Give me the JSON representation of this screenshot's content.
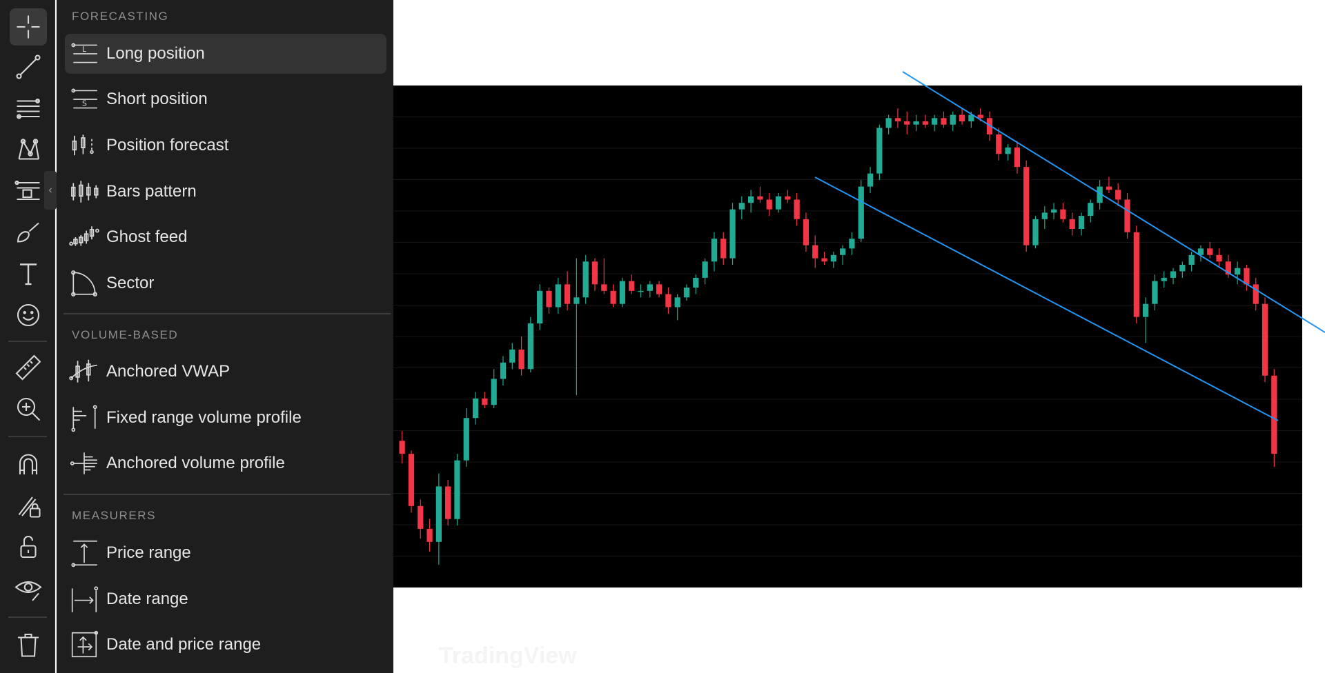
{
  "colors": {
    "panel_bg": "#1e1e1e",
    "chart_bg": "#000000",
    "up_candle": "#22ab94",
    "down_candle": "#f23645",
    "trendline": "#2196f3",
    "icon": "#d6d6d6"
  },
  "toolbar": {
    "items": [
      {
        "name": "crosshair-icon",
        "active": true
      },
      {
        "name": "trend-line-icon"
      },
      {
        "name": "fib-retracement-icon"
      },
      {
        "name": "patterns-icon"
      },
      {
        "name": "forecasting-icon"
      },
      {
        "name": "brush-icon"
      },
      {
        "name": "text-icon"
      },
      {
        "name": "emoji-icon"
      },
      {
        "name": "ruler-icon"
      },
      {
        "name": "zoom-in-icon"
      },
      {
        "name": "magnet-icon"
      },
      {
        "name": "lock-drawing-icon"
      },
      {
        "name": "unlock-icon"
      },
      {
        "name": "eye-icon"
      },
      {
        "name": "trash-icon"
      }
    ],
    "collapse_glyph": "‹"
  },
  "menu": {
    "sections": [
      {
        "title": "FORECASTING",
        "items": [
          {
            "label": "Long position",
            "icon": "long-position-icon",
            "selected": true
          },
          {
            "label": "Short position",
            "icon": "short-position-icon"
          },
          {
            "label": "Position forecast",
            "icon": "position-forecast-icon"
          },
          {
            "label": "Bars pattern",
            "icon": "bars-pattern-icon"
          },
          {
            "label": "Ghost feed",
            "icon": "ghost-feed-icon"
          },
          {
            "label": "Sector",
            "icon": "sector-icon"
          }
        ]
      },
      {
        "title": "VOLUME-BASED",
        "items": [
          {
            "label": "Anchored VWAP",
            "icon": "anchored-vwap-icon"
          },
          {
            "label": "Fixed range volume profile",
            "icon": "fixed-range-volume-profile-icon"
          },
          {
            "label": "Anchored volume profile",
            "icon": "anchored-volume-profile-icon"
          }
        ]
      },
      {
        "title": "MEASURERS",
        "items": [
          {
            "label": "Price range",
            "icon": "price-range-icon"
          },
          {
            "label": "Date range",
            "icon": "date-range-icon"
          },
          {
            "label": "Date and price range",
            "icon": "date-and-price-range-icon"
          }
        ]
      }
    ]
  },
  "chart_data": {
    "type": "candlestick",
    "ylim": [
      0,
      100
    ],
    "grid": true,
    "candles": [
      {
        "o": 40,
        "h": 43,
        "l": 33,
        "c": 36
      },
      {
        "o": 36,
        "h": 37,
        "l": 18,
        "c": 20
      },
      {
        "o": 20,
        "h": 22,
        "l": 10,
        "c": 13
      },
      {
        "o": 13,
        "h": 16,
        "l": 6,
        "c": 9
      },
      {
        "o": 9,
        "h": 30,
        "l": 2,
        "c": 26
      },
      {
        "o": 26,
        "h": 28,
        "l": 14,
        "c": 16
      },
      {
        "o": 16,
        "h": 36,
        "l": 14,
        "c": 34
      },
      {
        "o": 34,
        "h": 50,
        "l": 32,
        "c": 47
      },
      {
        "o": 47,
        "h": 55,
        "l": 45,
        "c": 53
      },
      {
        "o": 53,
        "h": 55,
        "l": 50,
        "c": 51
      },
      {
        "o": 51,
        "h": 62,
        "l": 50,
        "c": 59
      },
      {
        "o": 59,
        "h": 66,
        "l": 57,
        "c": 64
      },
      {
        "o": 64,
        "h": 70,
        "l": 62,
        "c": 68
      },
      {
        "o": 68,
        "h": 72,
        "l": 60,
        "c": 62
      },
      {
        "o": 62,
        "h": 78,
        "l": 61,
        "c": 76
      },
      {
        "o": 76,
        "h": 88,
        "l": 74,
        "c": 86
      },
      {
        "o": 86,
        "h": 87,
        "l": 79,
        "c": 81
      },
      {
        "o": 81,
        "h": 90,
        "l": 79,
        "c": 88
      },
      {
        "o": 88,
        "h": 92,
        "l": 80,
        "c": 82
      },
      {
        "o": 82,
        "h": 96,
        "l": 54,
        "c": 84
      },
      {
        "o": 84,
        "h": 97,
        "l": 82,
        "c": 95
      },
      {
        "o": 95,
        "h": 96,
        "l": 86,
        "c": 88
      },
      {
        "o": 88,
        "h": 96,
        "l": 85,
        "c": 86
      },
      {
        "o": 86,
        "h": 88,
        "l": 81,
        "c": 82
      },
      {
        "o": 82,
        "h": 90,
        "l": 81,
        "c": 89
      },
      {
        "o": 89,
        "h": 91,
        "l": 85,
        "c": 86
      },
      {
        "o": 86,
        "h": 88,
        "l": 84,
        "c": 86
      },
      {
        "o": 86,
        "h": 89,
        "l": 84,
        "c": 88
      },
      {
        "o": 88,
        "h": 89,
        "l": 84,
        "c": 85
      },
      {
        "o": 85,
        "h": 87,
        "l": 79,
        "c": 81
      },
      {
        "o": 81,
        "h": 85,
        "l": 77,
        "c": 84
      },
      {
        "o": 84,
        "h": 88,
        "l": 83,
        "c": 87
      },
      {
        "o": 87,
        "h": 91,
        "l": 85,
        "c": 90
      },
      {
        "o": 90,
        "h": 96,
        "l": 88,
        "c": 95
      },
      {
        "o": 95,
        "h": 104,
        "l": 92,
        "c": 102
      },
      {
        "o": 102,
        "h": 104,
        "l": 94,
        "c": 96
      },
      {
        "o": 96,
        "h": 113,
        "l": 94,
        "c": 111
      },
      {
        "o": 111,
        "h": 115,
        "l": 108,
        "c": 113
      },
      {
        "o": 113,
        "h": 117,
        "l": 110,
        "c": 115
      },
      {
        "o": 115,
        "h": 118,
        "l": 113,
        "c": 114
      },
      {
        "o": 114,
        "h": 116,
        "l": 109,
        "c": 111
      },
      {
        "o": 111,
        "h": 116,
        "l": 110,
        "c": 115
      },
      {
        "o": 115,
        "h": 117,
        "l": 113,
        "c": 114
      },
      {
        "o": 114,
        "h": 116,
        "l": 106,
        "c": 108
      },
      {
        "o": 108,
        "h": 110,
        "l": 98,
        "c": 100
      },
      {
        "o": 100,
        "h": 103,
        "l": 93,
        "c": 96
      },
      {
        "o": 96,
        "h": 98,
        "l": 94,
        "c": 95
      },
      {
        "o": 95,
        "h": 98,
        "l": 93,
        "c": 97
      },
      {
        "o": 97,
        "h": 100,
        "l": 94,
        "c": 99
      },
      {
        "o": 99,
        "h": 104,
        "l": 97,
        "c": 102
      },
      {
        "o": 102,
        "h": 120,
        "l": 101,
        "c": 118
      },
      {
        "o": 118,
        "h": 124,
        "l": 116,
        "c": 122
      },
      {
        "o": 122,
        "h": 137,
        "l": 120,
        "c": 136
      },
      {
        "o": 136,
        "h": 140,
        "l": 134,
        "c": 139
      },
      {
        "o": 139,
        "h": 142,
        "l": 136,
        "c": 138
      },
      {
        "o": 138,
        "h": 141,
        "l": 134,
        "c": 137
      },
      {
        "o": 137,
        "h": 140,
        "l": 135,
        "c": 138
      },
      {
        "o": 138,
        "h": 140,
        "l": 136,
        "c": 137
      },
      {
        "o": 137,
        "h": 140,
        "l": 135,
        "c": 139
      },
      {
        "o": 139,
        "h": 141,
        "l": 136,
        "c": 137
      },
      {
        "o": 137,
        "h": 141,
        "l": 135,
        "c": 140
      },
      {
        "o": 140,
        "h": 142,
        "l": 137,
        "c": 138
      },
      {
        "o": 138,
        "h": 141,
        "l": 136,
        "c": 140
      },
      {
        "o": 140,
        "h": 142,
        "l": 138,
        "c": 139
      },
      {
        "o": 139,
        "h": 141,
        "l": 132,
        "c": 134
      },
      {
        "o": 134,
        "h": 136,
        "l": 126,
        "c": 128
      },
      {
        "o": 128,
        "h": 131,
        "l": 126,
        "c": 130
      },
      {
        "o": 130,
        "h": 132,
        "l": 122,
        "c": 124
      },
      {
        "o": 124,
        "h": 126,
        "l": 98,
        "c": 100
      },
      {
        "o": 100,
        "h": 109,
        "l": 99,
        "c": 108
      },
      {
        "o": 108,
        "h": 112,
        "l": 105,
        "c": 110
      },
      {
        "o": 110,
        "h": 113,
        "l": 108,
        "c": 111
      },
      {
        "o": 111,
        "h": 113,
        "l": 107,
        "c": 108
      },
      {
        "o": 108,
        "h": 110,
        "l": 103,
        "c": 105
      },
      {
        "o": 105,
        "h": 110,
        "l": 103,
        "c": 109
      },
      {
        "o": 109,
        "h": 114,
        "l": 107,
        "c": 113
      },
      {
        "o": 113,
        "h": 120,
        "l": 111,
        "c": 118
      },
      {
        "o": 118,
        "h": 121,
        "l": 116,
        "c": 117
      },
      {
        "o": 117,
        "h": 119,
        "l": 112,
        "c": 114
      },
      {
        "o": 114,
        "h": 116,
        "l": 102,
        "c": 104
      },
      {
        "o": 104,
        "h": 106,
        "l": 76,
        "c": 78
      },
      {
        "o": 78,
        "h": 84,
        "l": 70,
        "c": 82
      },
      {
        "o": 82,
        "h": 91,
        "l": 80,
        "c": 89
      },
      {
        "o": 89,
        "h": 92,
        "l": 87,
        "c": 90
      },
      {
        "o": 90,
        "h": 93,
        "l": 88,
        "c": 92
      },
      {
        "o": 92,
        "h": 95,
        "l": 90,
        "c": 94
      },
      {
        "o": 94,
        "h": 98,
        "l": 92,
        "c": 97
      },
      {
        "o": 97,
        "h": 100,
        "l": 95,
        "c": 99
      },
      {
        "o": 99,
        "h": 101,
        "l": 96,
        "c": 97
      },
      {
        "o": 97,
        "h": 99,
        "l": 93,
        "c": 95
      },
      {
        "o": 95,
        "h": 97,
        "l": 90,
        "c": 91
      },
      {
        "o": 91,
        "h": 95,
        "l": 88,
        "c": 93
      },
      {
        "o": 93,
        "h": 94,
        "l": 86,
        "c": 88
      },
      {
        "o": 88,
        "h": 90,
        "l": 80,
        "c": 82
      },
      {
        "o": 82,
        "h": 84,
        "l": 58,
        "c": 60
      },
      {
        "o": 60,
        "h": 62,
        "l": 32,
        "c": 36
      }
    ],
    "trendlines": [
      {
        "x1": 0.455,
        "y1": 183,
        "x2": 1.02,
        "y2": 72
      },
      {
        "x1": 0.377,
        "y1": 138,
        "x2": 0.79,
        "y2": 50
      }
    ]
  },
  "watermark": {
    "text": "TradingView"
  }
}
